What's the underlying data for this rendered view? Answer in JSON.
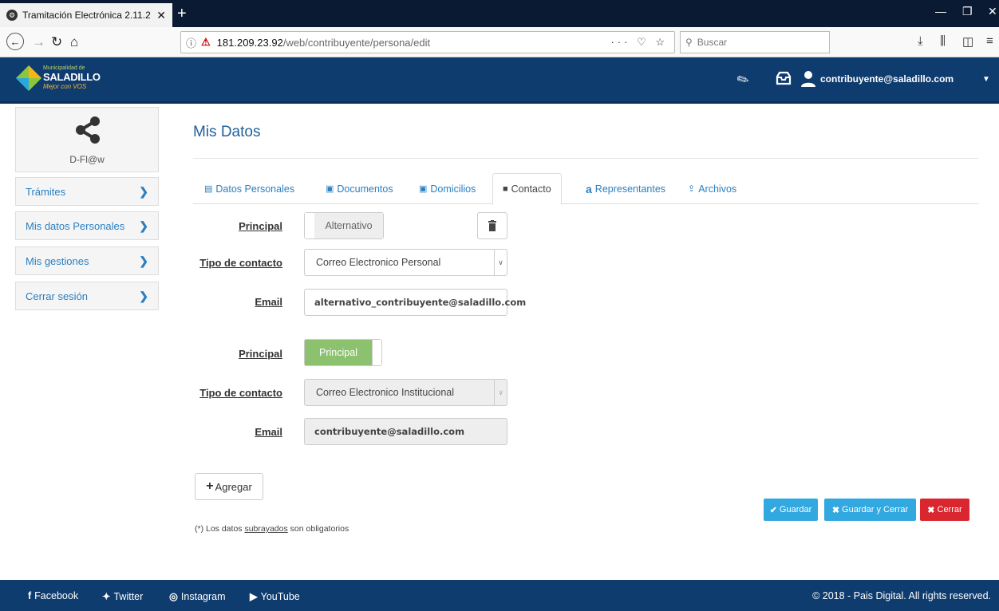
{
  "browser": {
    "tab_title": "Tramitación Electrónica 2.11.2",
    "tab_close": "✕",
    "new_tab": "+",
    "url_host": "181.209.23.92",
    "url_path": "/web/contribuyente/persona/edit",
    "url_tools": "··· ♡ ☆",
    "search_placeholder": "Buscar"
  },
  "header": {
    "logo_top": "Municipalidad de",
    "logo_name": "SALADILLO",
    "logo_tag": "Mejor con VOS",
    "user_email": "contribuyente@saladillo.com"
  },
  "sidebar": {
    "brand": "D-Fl@w",
    "items": [
      {
        "label": "Trámites"
      },
      {
        "label": "Mis datos Personales"
      },
      {
        "label": "Mis gestiones"
      },
      {
        "label": "Cerrar sesión"
      }
    ]
  },
  "main": {
    "title": "Mis Datos",
    "tabs": [
      {
        "label": "Datos Personales"
      },
      {
        "label": "Documentos"
      },
      {
        "label": "Domicilios"
      },
      {
        "label": "Contacto"
      },
      {
        "label": "Representantes"
      },
      {
        "label": "Archivos"
      }
    ],
    "contacts": [
      {
        "principal_label": "Principal",
        "toggle_text": "Alternativo",
        "tipo_label": "Tipo de contacto",
        "tipo_value": "Correo Electronico Personal",
        "email_label": "Email",
        "email_value": "alternativo_contribuyente@saladillo.com"
      },
      {
        "principal_label": "Principal",
        "toggle_text": "Principal",
        "tipo_label": "Tipo de contacto",
        "tipo_value": "Correo Electronico Institucional",
        "email_label": "Email",
        "email_value": "contribuyente@saladillo.com"
      }
    ],
    "add_label": "Agregar",
    "note_prefix": "(*) Los datos ",
    "note_underlined": "subrayados",
    "note_suffix": " son obligatorios",
    "buttons": {
      "save": "Guardar",
      "save_close": "Guardar y Cerrar",
      "close": "Cerrar"
    }
  },
  "footer": {
    "links": [
      {
        "label": "Facebook"
      },
      {
        "label": "Twitter"
      },
      {
        "label": "Instagram"
      },
      {
        "label": "YouTube"
      }
    ],
    "copyright": "2018 - Pais Digital. All rights reserved."
  },
  "colors": {
    "header_bg": "#0f3c6e",
    "link_blue": "#2a7fc1",
    "toggle_green": "#8cc26e",
    "btn_blue": "#31a8e0",
    "btn_red": "#d9262f"
  }
}
